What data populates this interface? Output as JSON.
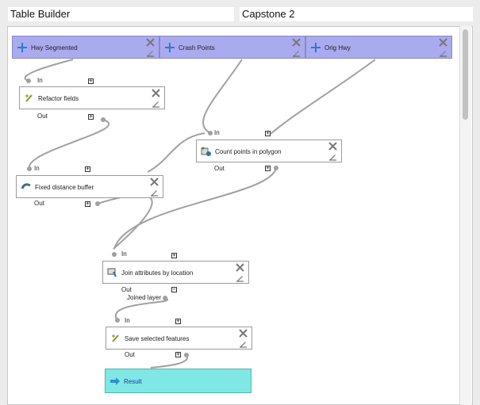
{
  "header": {
    "model_name": "Table Builder",
    "group_name": "Capstone 2"
  },
  "inputs": [
    {
      "label": "Hwy Segmented",
      "icon": "plus-icon"
    },
    {
      "label": "Crash Points",
      "icon": "plus-icon"
    },
    {
      "label": "Orig Hwy",
      "icon": "plus-icon"
    }
  ],
  "algorithms": {
    "refactor": {
      "label": "Refactor fields",
      "in": "In",
      "out": "Out"
    },
    "count": {
      "label": "Count points in polygon",
      "in": "In",
      "out": "Out"
    },
    "buffer": {
      "label": "Fixed distance buffer",
      "in": "In",
      "out": "Out"
    },
    "join": {
      "label": "Join attributes by location",
      "in": "In",
      "out": "Out",
      "joined": "Joined layer"
    },
    "save": {
      "label": "Save selected features",
      "in": "In",
      "out": "Out"
    }
  },
  "outputs": [
    {
      "label": "Result",
      "icon": "arrow-right-icon"
    }
  ],
  "toggles": {
    "expand": "+",
    "collapse": "−"
  },
  "colors": {
    "input_fill": "#aaaaee",
    "output_fill": "#80e8e4",
    "wire": "#a0a0a0"
  }
}
